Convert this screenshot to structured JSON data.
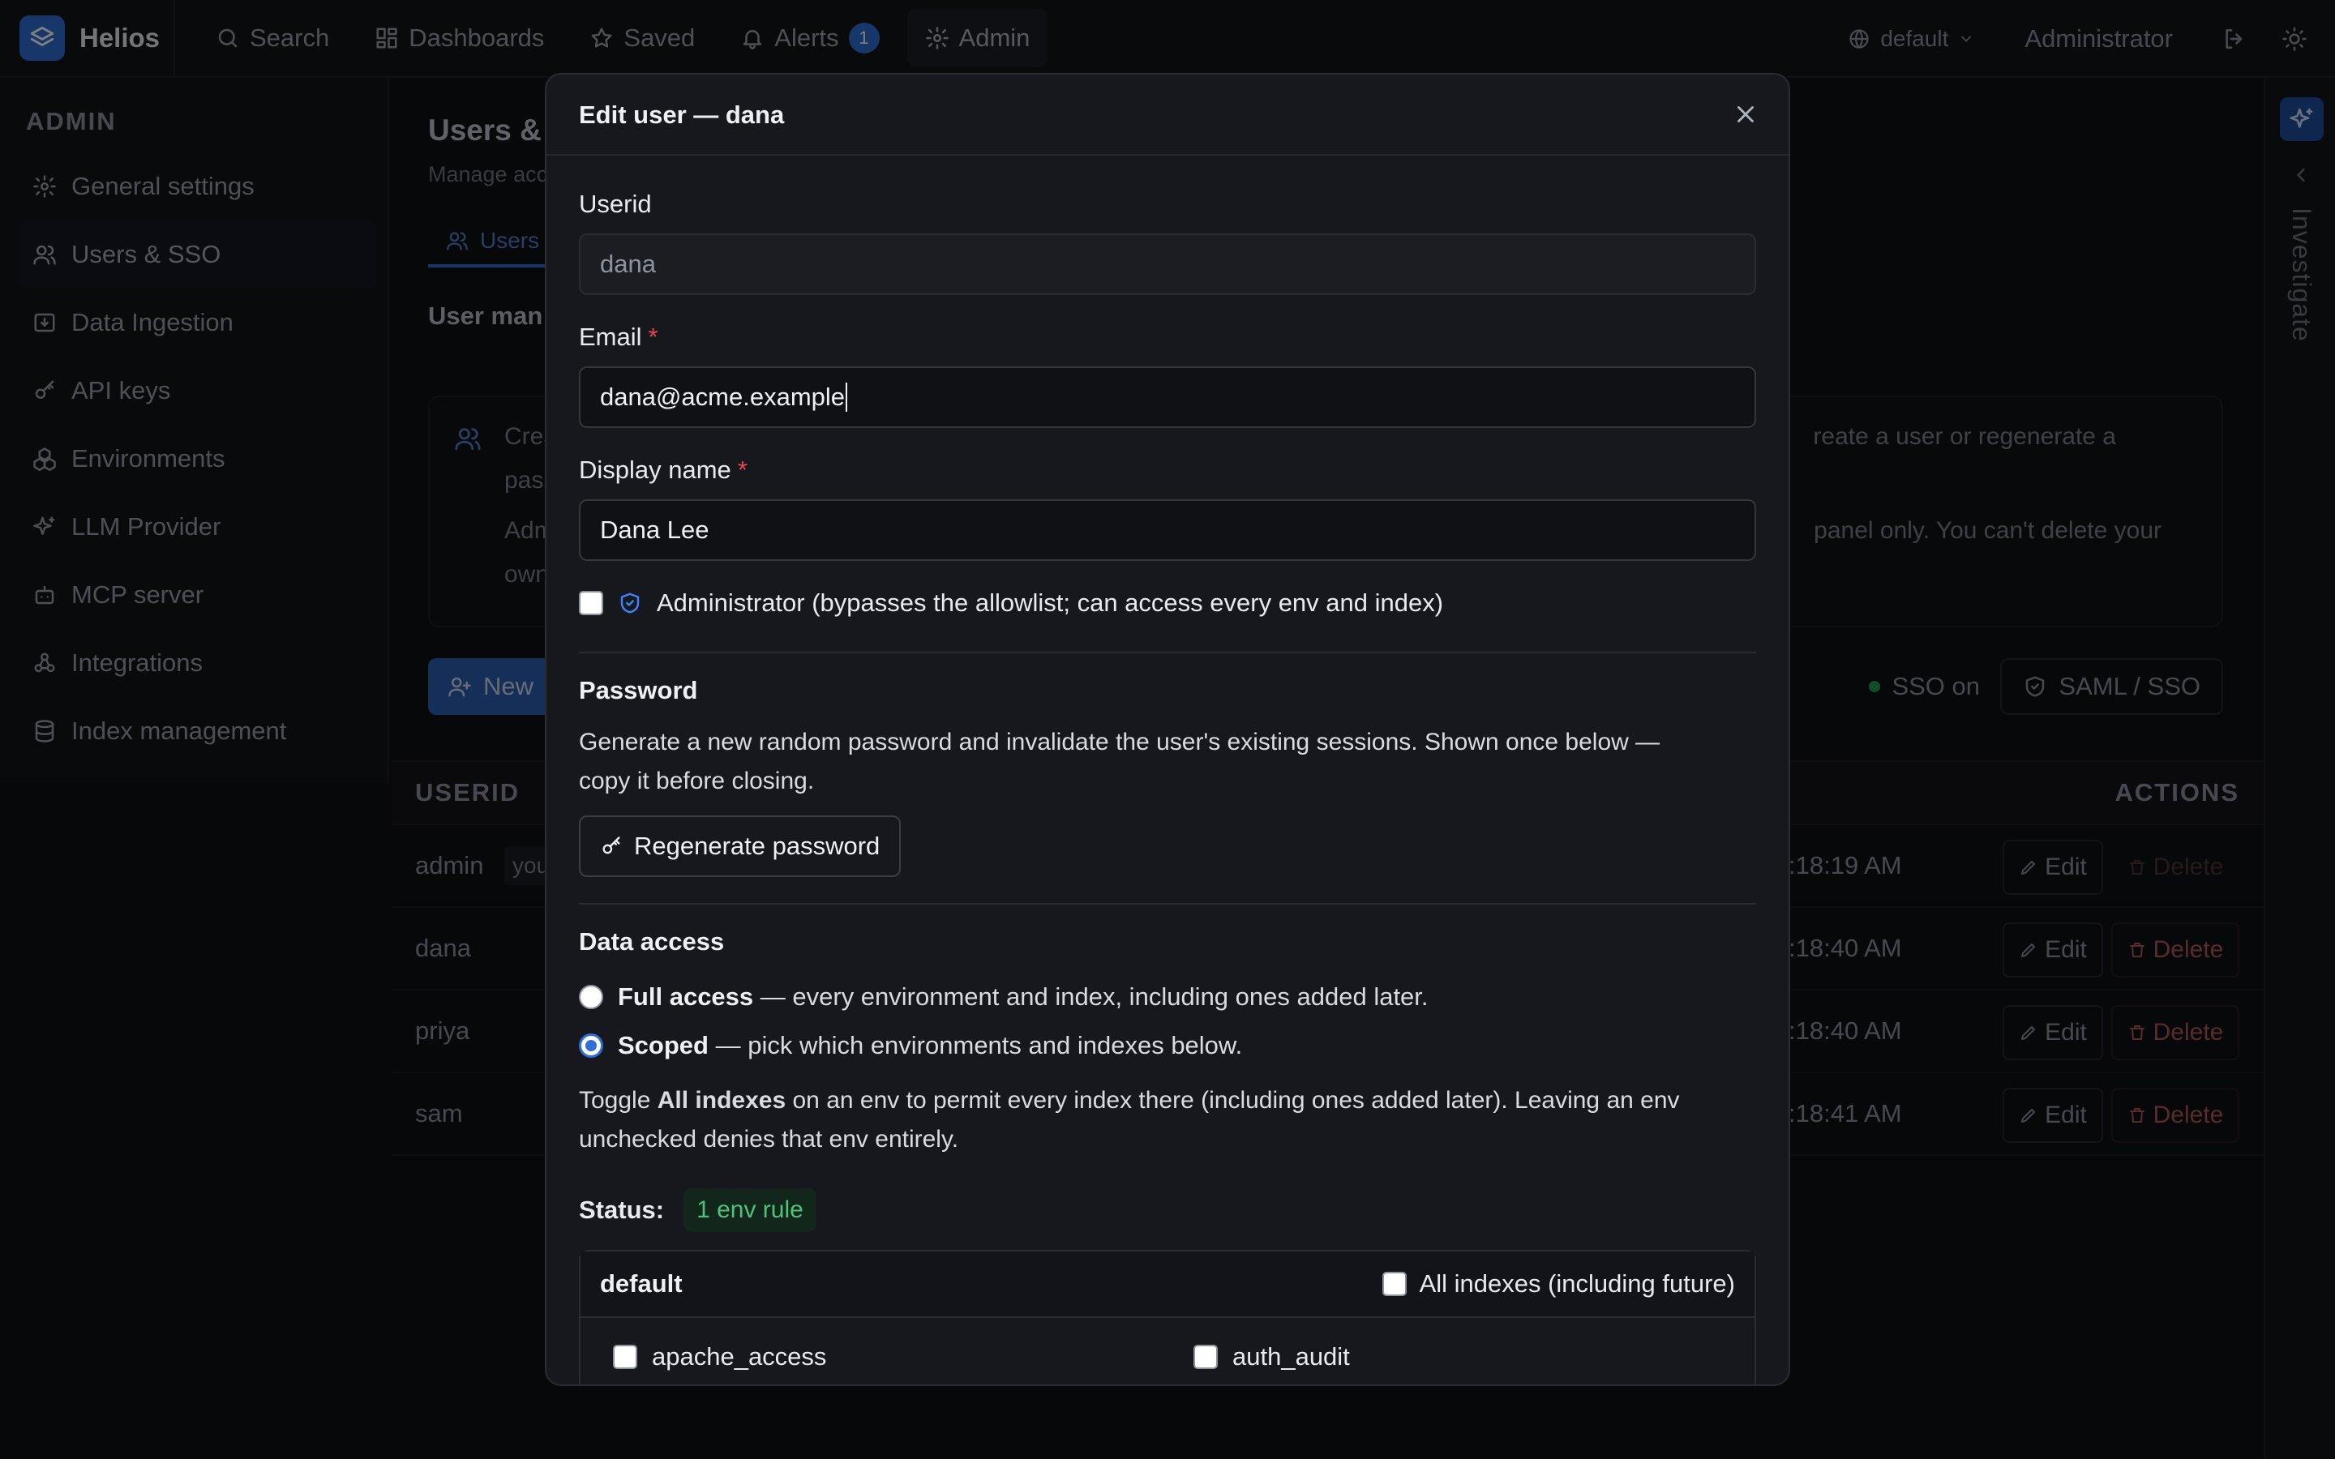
{
  "app": {
    "name": "Helios"
  },
  "nav": {
    "search": "Search",
    "dashboards": "Dashboards",
    "saved": "Saved",
    "alerts": "Alerts",
    "alerts_count": "1",
    "admin": "Admin"
  },
  "topbar": {
    "env": "default",
    "user": "Administrator"
  },
  "sidebar": {
    "heading": "ADMIN",
    "items": [
      {
        "label": "General settings"
      },
      {
        "label": "Users & SSO"
      },
      {
        "label": "Data Ingestion"
      },
      {
        "label": "API keys"
      },
      {
        "label": "Environments"
      },
      {
        "label": "LLM Provider"
      },
      {
        "label": "MCP server"
      },
      {
        "label": "Integrations"
      },
      {
        "label": "Index management"
      }
    ]
  },
  "main": {
    "title": "Users &",
    "subtitle": "Manage acc",
    "tab": "Users",
    "section": "User man",
    "info": {
      "l1": "Crea",
      "l1b": "pass",
      "l2": "Adm",
      "l2b": "own",
      "r1": "reate a user or regenerate a",
      "r2": "panel only. You can't delete your"
    },
    "new_button": "New",
    "sso_status": "SSO on",
    "saml_button": "SAML / SSO",
    "table": {
      "col_userid": "USERID",
      "col_actions": "ACTIONS",
      "rows": [
        {
          "userid": "admin",
          "tag": "you",
          "time": ":18:19 AM",
          "edit": "Edit",
          "delete": "Delete"
        },
        {
          "userid": "dana",
          "time": ":18:40 AM",
          "edit": "Edit",
          "delete": "Delete"
        },
        {
          "userid": "priya",
          "time": ":18:40 AM",
          "edit": "Edit",
          "delete": "Delete"
        },
        {
          "userid": "sam",
          "time": ":18:41 AM",
          "edit": "Edit",
          "delete": "Delete"
        }
      ]
    }
  },
  "rail": {
    "label": "Investigate"
  },
  "modal": {
    "title": "Edit user — dana",
    "userid_label": "Userid",
    "userid_value": "dana",
    "email_label": "Email",
    "email_value": "dana@acme.example",
    "display_label": "Display name",
    "display_value": "Dana Lee",
    "required_mark": "*",
    "admin_checkbox": "Administrator (bypasses the allowlist; can access every env and index)",
    "password": {
      "heading": "Password",
      "desc1": "Generate a new random password and invalidate the user's existing sessions. Shown once below —",
      "desc2": "copy it before closing.",
      "button": "Regenerate password"
    },
    "access": {
      "heading": "Data access",
      "full_bold": "Full access",
      "full_rest": "— every environment and index, including ones added later.",
      "scoped_bold": "Scoped",
      "scoped_rest": "— pick which environments and indexes below.",
      "toggle_pre": "Toggle",
      "toggle_bold": "All indexes",
      "toggle_post": "on an env to permit every index there (including ones added later). Leaving an env",
      "toggle_line2": "unchecked denies that env entirely.",
      "status_label": "Status:",
      "status_value": "1 env rule",
      "env_name": "default",
      "all_indexes": "All indexes (including future)",
      "indexes": [
        "apache_access",
        "auth_audit"
      ]
    }
  },
  "colors": {
    "accent": "#2f6fd6",
    "danger": "#e5484d",
    "success": "#4cc27a"
  }
}
